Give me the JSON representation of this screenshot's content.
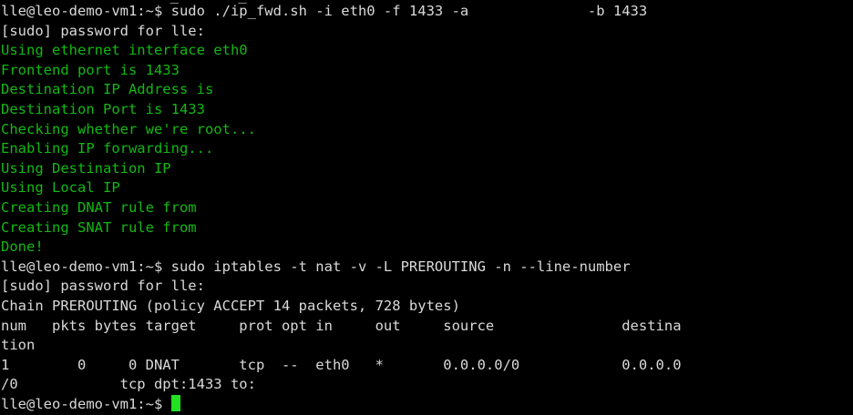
{
  "terminal": {
    "partial_top": "                    _       _",
    "lines": [
      {
        "kind": "prompt",
        "prompt": "lle@leo-demo-vm1:~$ ",
        "command": "sudo ./ip_fwd.sh -i eth0 -f 1433 -a              -b 1433"
      },
      {
        "kind": "output",
        "text": "[sudo] password for lle:"
      },
      {
        "kind": "green",
        "text": "Using ethernet interface eth0"
      },
      {
        "kind": "green",
        "text": "Frontend port is 1433"
      },
      {
        "kind": "green",
        "text": "Destination IP Address is"
      },
      {
        "kind": "green",
        "text": "Destination Port is 1433"
      },
      {
        "kind": "green",
        "text": "Checking whether we're root..."
      },
      {
        "kind": "green",
        "text": "Enabling IP forwarding..."
      },
      {
        "kind": "green",
        "text": "Using Destination IP"
      },
      {
        "kind": "green",
        "text": "Using Local IP"
      },
      {
        "kind": "green",
        "text": "Creating DNAT rule from"
      },
      {
        "kind": "green",
        "text": "Creating SNAT rule from"
      },
      {
        "kind": "green",
        "text": "Done!"
      },
      {
        "kind": "prompt",
        "prompt": "lle@leo-demo-vm1:~$ ",
        "command": "sudo iptables -t nat -v -L PREROUTING -n --line-number"
      },
      {
        "kind": "output",
        "text": "[sudo] password for lle:"
      },
      {
        "kind": "output",
        "text": "Chain PREROUTING (policy ACCEPT 14 packets, 728 bytes)"
      },
      {
        "kind": "output",
        "text": "num   pkts bytes target     prot opt in     out     source               destina"
      },
      {
        "kind": "output",
        "text": "tion"
      },
      {
        "kind": "output",
        "text": "1        0     0 DNAT       tcp  --  eth0   *       0.0.0.0/0            0.0.0.0"
      },
      {
        "kind": "output",
        "text": "/0            tcp dpt:1433 to:"
      },
      {
        "kind": "current",
        "prompt": "lle@leo-demo-vm1:~$ ",
        "command": ""
      }
    ],
    "colors": {
      "background": "#000000",
      "text": "#d9d9d9",
      "green_output": "#12b812",
      "cursor": "#22e022"
    }
  }
}
